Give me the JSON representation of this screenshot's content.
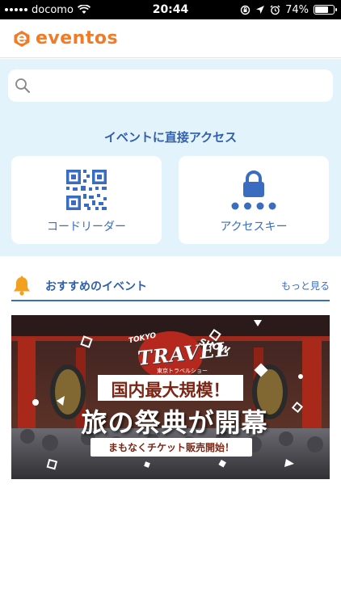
{
  "status_bar": {
    "carrier": "docomo",
    "time": "20:44",
    "battery": "74%",
    "battery_level": 0.74
  },
  "header": {
    "logo_text": "eventos",
    "brand_color": "#f07c27"
  },
  "search": {
    "placeholder": "",
    "value": ""
  },
  "direct_access": {
    "title": "イベントに直接アクセス",
    "code_reader_label": "コードリーダー",
    "access_key_label": "アクセスキー"
  },
  "recommended": {
    "title": "おすすめのイベント",
    "more_link": "もっと見る"
  },
  "banner": {
    "tokyo": "TOKYO",
    "travel": "TRAVEL",
    "show": "SHOW",
    "subtitle": "東京トラベルショー",
    "headline": "国内最大規模！",
    "main_text": "旅の祭典が開幕",
    "ticket_text": "まもなくチケット販売開始！"
  },
  "colors": {
    "accent_blue": "#3a6cc0",
    "light_blue_bg": "#e3f3fb",
    "bell": "#f2a01e"
  }
}
